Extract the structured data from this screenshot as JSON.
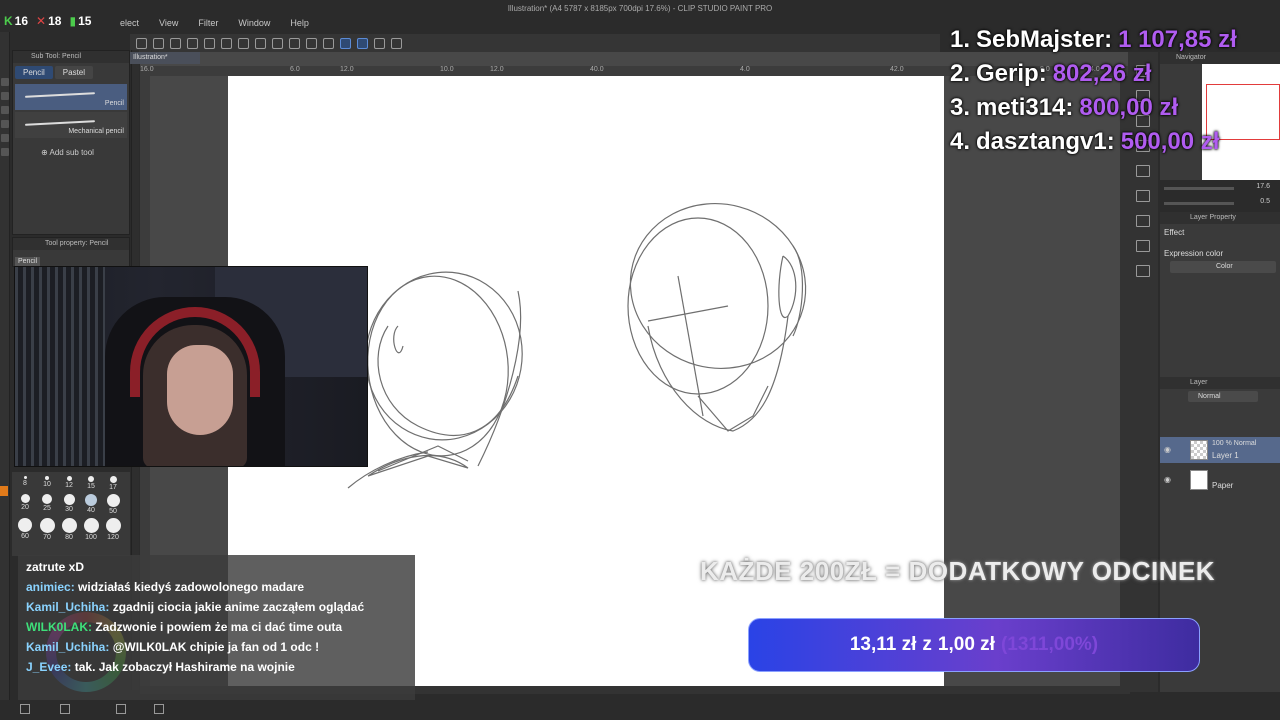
{
  "window": {
    "title": "Illustration* (A4 5787 x 8185px 700dpi 17.6%) - CLIP STUDIO PAINT PRO"
  },
  "menu": [
    "elect",
    "View",
    "Filter",
    "Window",
    "Help"
  ],
  "counters": {
    "kills": "16",
    "deaths": "18",
    "followers": "15"
  },
  "subtool": {
    "header": "Sub Tool: Pencil",
    "tabs": [
      "Pencil",
      "Pastel"
    ],
    "items": [
      "Pencil",
      "Mechanical pencil"
    ],
    "add_label": "Add sub tool"
  },
  "toolprop": {
    "header": "Tool property: Pencil",
    "chip": "Pencil"
  },
  "brush_sizes": [
    "8",
    "10",
    "12",
    "15",
    "17",
    "20",
    "25",
    "30",
    "40",
    "50",
    "60",
    "70",
    "80",
    "100",
    "120"
  ],
  "doc_tab": "Illustration*",
  "ruler_ticks": [
    "16.0",
    "",
    "",
    "6.0",
    "12.0",
    "",
    "10.0",
    "12.0",
    "",
    "40.0",
    "",
    "",
    "4.0",
    "",
    "",
    "42.0",
    "",
    "",
    "8.0",
    "4.0"
  ],
  "navigator": {
    "header": "Navigator",
    "zoom": "17.6",
    "angle": "0.5"
  },
  "layer_property": {
    "header": "Layer Property",
    "effect_label": "Effect",
    "expression_label": "Expression color",
    "expression_value": "Color"
  },
  "layers": {
    "header": "Layer",
    "blend_mode": "Normal",
    "rows": [
      {
        "line1": "100 % Normal",
        "line2": "Layer 1"
      },
      {
        "line1": "",
        "line2": "Paper"
      }
    ]
  },
  "leaderboard": [
    {
      "rank": "1.",
      "name": "SebMajster:",
      "amount": "1 107,85 zł"
    },
    {
      "rank": "2.",
      "name": "Gerip:",
      "amount": "802,26 zł"
    },
    {
      "rank": "3.",
      "name": "meti314:",
      "amount": "800,00 zł"
    },
    {
      "rank": "4.",
      "name": "dasztangv1:",
      "amount": "500,00 zł"
    }
  ],
  "donation": {
    "title": "KAŻDE 200ZŁ = DODATKOWY ODCINEK",
    "current": "13,11 zł",
    "connector": "z",
    "goal": "1,00 zł",
    "percent": "(1311,00%)"
  },
  "chat": [
    {
      "user": "",
      "text": "zatrute xD"
    },
    {
      "user": "animiec:",
      "text": "widziałaś kiedyś zadowolonego madare"
    },
    {
      "user": "Kamil_Uchiha:",
      "text": "zgadnij ciocia jakie anime zacząłem oglądać"
    },
    {
      "user": "WILK0LAK:",
      "text": "Zadzwonie i powiem że ma ci dać time outa"
    },
    {
      "user": "Kamil_Uchiha:",
      "text": "@WILK0LAK chipie ja fan od 1 odc !"
    },
    {
      "user": "J_Evee:",
      "text": "tak. Jak zobaczył Hashirame na wojnie"
    }
  ],
  "colors": {
    "accent": "#b05cf0",
    "goal_bar": "#2a43e6",
    "chat_user": "#8ad3ff"
  }
}
